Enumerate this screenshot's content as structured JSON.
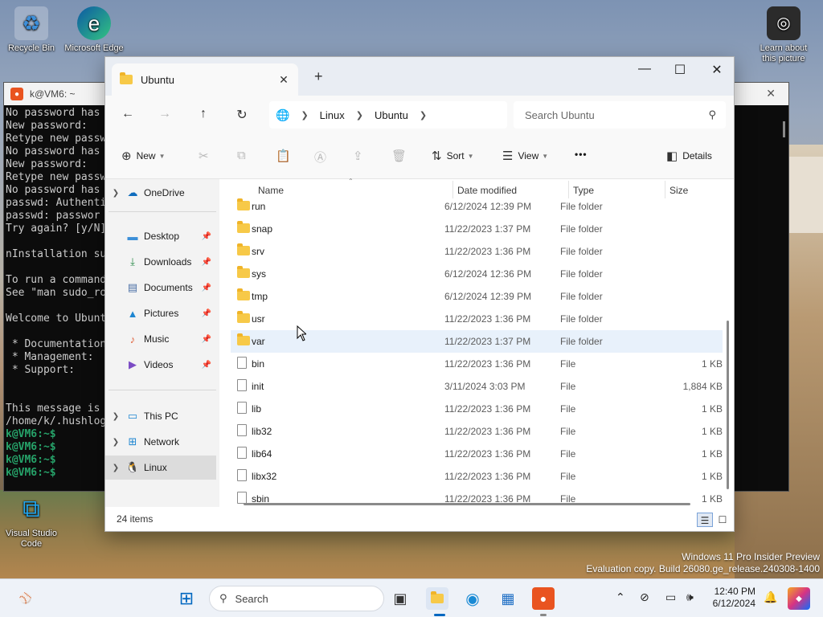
{
  "desktop": {
    "icons": [
      {
        "label": "Recycle Bin",
        "icon": "recycle-bin-icon"
      },
      {
        "label": "Microsoft Edge",
        "icon": "edge-icon"
      },
      {
        "label": "Learn about this picture",
        "icon": "camera-icon"
      },
      {
        "label": "Visual Studio Code",
        "icon": "vscode-icon"
      }
    ]
  },
  "terminal": {
    "title": "k@VM6: ~",
    "lines": [
      "No password has",
      "New password:",
      "Retype new passw",
      "No password has",
      "New password:",
      "Retype new passw",
      "No password has",
      "passwd: Authenti",
      "passwd: passwor",
      "Try again? [y/N]",
      "",
      "nInstallation su",
      "",
      "To run a command",
      "See \"man sudo_ro",
      "",
      "Welcome to Ubunt",
      "",
      " * Documentation",
      " * Management:",
      " * Support:",
      "",
      "",
      "This message is",
      "/home/k/.hushlog"
    ],
    "prompts": [
      "k@VM6:~$",
      "k@VM6:~$",
      "k@VM6:~$",
      "k@VM6:~$"
    ]
  },
  "explorer": {
    "tab_title": "Ubuntu",
    "new_tab": "+",
    "breadcrumb": [
      "Linux",
      "Ubuntu"
    ],
    "search_placeholder": "Search Ubuntu",
    "commands": {
      "new": "New",
      "sort": "Sort",
      "view": "View",
      "more": "•••",
      "details": "Details"
    },
    "nav": {
      "onedrive": "OneDrive",
      "quick_access": [
        {
          "label": "Desktop",
          "icon": "desktop-icon"
        },
        {
          "label": "Downloads",
          "icon": "download-icon"
        },
        {
          "label": "Documents",
          "icon": "documents-icon"
        },
        {
          "label": "Pictures",
          "icon": "pictures-icon"
        },
        {
          "label": "Music",
          "icon": "music-icon"
        },
        {
          "label": "Videos",
          "icon": "videos-icon"
        }
      ],
      "this_pc": "This PC",
      "network": "Network",
      "linux": "Linux"
    },
    "columns": {
      "name": "Name",
      "date": "Date modified",
      "type": "Type",
      "size": "Size"
    },
    "rows": [
      {
        "name": "run",
        "date": "6/12/2024 12:39 PM",
        "type": "File folder",
        "size": "",
        "kind": "folder"
      },
      {
        "name": "snap",
        "date": "11/22/2023 1:37 PM",
        "type": "File folder",
        "size": "",
        "kind": "folder"
      },
      {
        "name": "srv",
        "date": "11/22/2023 1:36 PM",
        "type": "File folder",
        "size": "",
        "kind": "folder"
      },
      {
        "name": "sys",
        "date": "6/12/2024 12:36 PM",
        "type": "File folder",
        "size": "",
        "kind": "folder"
      },
      {
        "name": "tmp",
        "date": "6/12/2024 12:39 PM",
        "type": "File folder",
        "size": "",
        "kind": "folder"
      },
      {
        "name": "usr",
        "date": "11/22/2023 1:36 PM",
        "type": "File folder",
        "size": "",
        "kind": "folder"
      },
      {
        "name": "var",
        "date": "11/22/2023 1:37 PM",
        "type": "File folder",
        "size": "",
        "kind": "folder"
      },
      {
        "name": "bin",
        "date": "11/22/2023 1:36 PM",
        "type": "File",
        "size": "1 KB",
        "kind": "file"
      },
      {
        "name": "init",
        "date": "3/11/2024 3:03 PM",
        "type": "File",
        "size": "1,884 KB",
        "kind": "file"
      },
      {
        "name": "lib",
        "date": "11/22/2023 1:36 PM",
        "type": "File",
        "size": "1 KB",
        "kind": "file"
      },
      {
        "name": "lib32",
        "date": "11/22/2023 1:36 PM",
        "type": "File",
        "size": "1 KB",
        "kind": "file"
      },
      {
        "name": "lib64",
        "date": "11/22/2023 1:36 PM",
        "type": "File",
        "size": "1 KB",
        "kind": "file"
      },
      {
        "name": "libx32",
        "date": "11/22/2023 1:36 PM",
        "type": "File",
        "size": "1 KB",
        "kind": "file"
      },
      {
        "name": "sbin",
        "date": "11/22/2023 1:36 PM",
        "type": "File",
        "size": "1 KB",
        "kind": "file"
      }
    ],
    "status": "24 items"
  },
  "watermark": {
    "line1": "Windows 11 Pro Insider Preview",
    "line2": "Evaluation copy. Build 26080.ge_release.240308-1400"
  },
  "taskbar": {
    "search": "Search",
    "time": "12:40 PM",
    "date": "6/12/2024"
  },
  "colors": {
    "folder": "#f7c948",
    "ubuntu": "#e95420",
    "selection": "#e8f1fb",
    "accent": "#0067c0"
  }
}
